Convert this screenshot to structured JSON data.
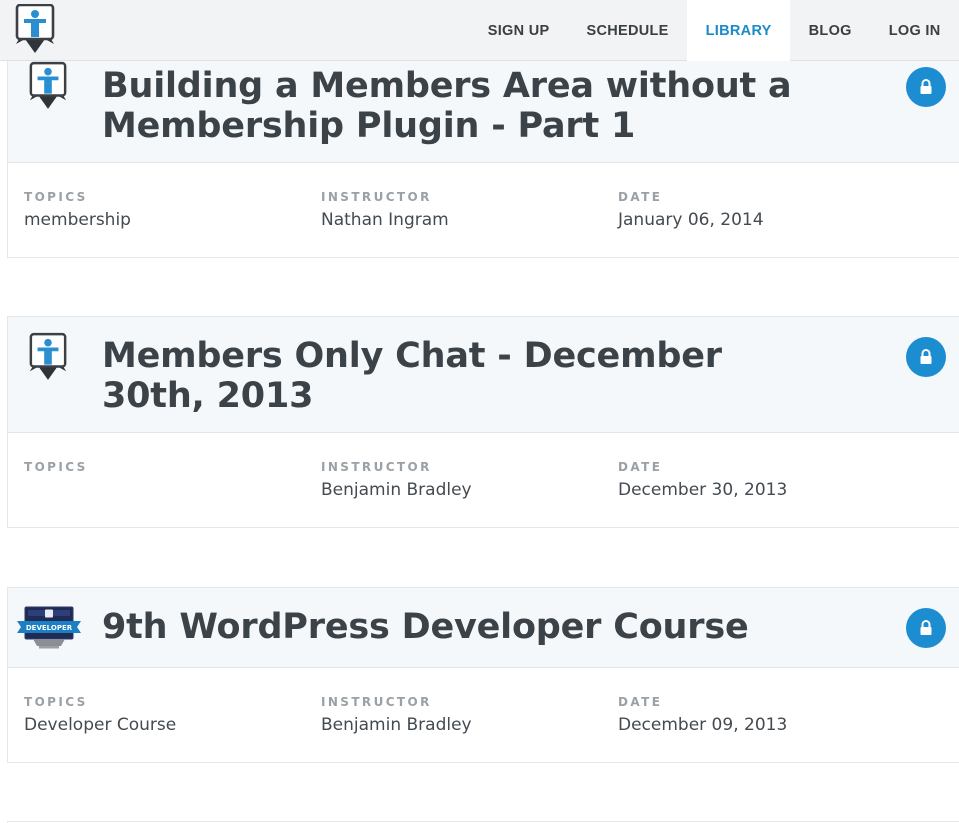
{
  "nav": {
    "items": [
      {
        "label": "SIGN UP",
        "active": false
      },
      {
        "label": "SCHEDULE",
        "active": false
      },
      {
        "label": "LIBRARY",
        "active": true
      },
      {
        "label": "BLOG",
        "active": false
      },
      {
        "label": "LOG IN",
        "active": false
      }
    ]
  },
  "meta_labels": {
    "topics": "TOPICS",
    "instructor": "INSTRUCTOR",
    "date": "DATE"
  },
  "items": [
    {
      "title": "Building a Members Area without a Membership Plugin - Part 1",
      "topics": "membership",
      "instructor": "Nathan Ingram",
      "date": "January 06, 2014",
      "icon": "ithemes-mascot-icon",
      "locked": true
    },
    {
      "title": "Members Only Chat - December 30th, 2013",
      "topics": "",
      "instructor": "Benjamin Bradley",
      "date": "December 30, 2013",
      "icon": "ithemes-mascot-icon",
      "locked": true
    },
    {
      "title": "9th WordPress Developer Course",
      "topics": "Developer Course",
      "instructor": "Benjamin Bradley",
      "date": "December 09, 2013",
      "icon": "developer-course-icon",
      "developer_badge_text": "DEVELOPER",
      "locked": true
    }
  ],
  "colors": {
    "accent": "#1b8dd0",
    "header_bg": "#f1f3f4",
    "card_head_bg": "#f5f8fa",
    "title_text": "#3b4248",
    "label_text": "#9aa1a6"
  }
}
